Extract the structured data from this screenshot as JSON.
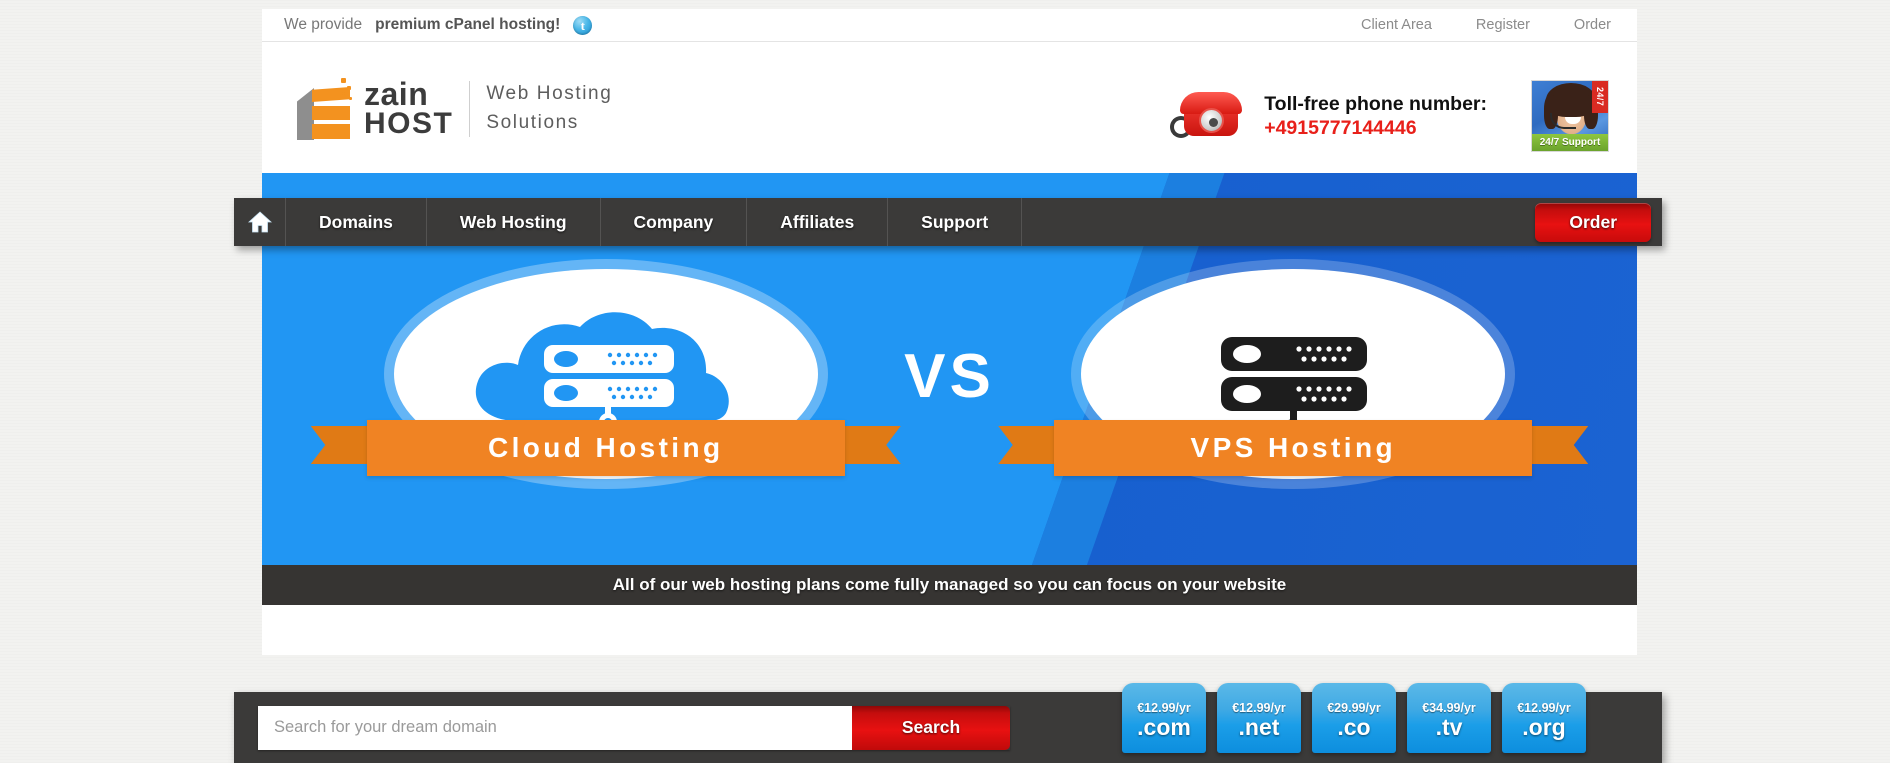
{
  "topbar": {
    "message_prefix": "We provide ",
    "message_bold": "premium cPanel hosting!",
    "social_icon": "twitter-icon",
    "links": [
      {
        "label": "Client Area"
      },
      {
        "label": "Register"
      },
      {
        "label": "Order"
      }
    ]
  },
  "header": {
    "logo": {
      "line1": "zain",
      "line2": "HOST",
      "tagline_line1": "Web Hosting",
      "tagline_line2": "Solutions",
      "mark_color_orange": "#f3921f",
      "mark_color_gray": "#8e8e8e"
    },
    "phone": {
      "icon": "telephone-icon",
      "label": "Toll-free phone number:",
      "number": "+4915777144446",
      "number_color": "#e8201a"
    },
    "support_badge": {
      "corner_label": "24/7",
      "caption": "24/7 Support"
    }
  },
  "nav": {
    "home_icon": "home-icon",
    "items": [
      {
        "label": "Domains"
      },
      {
        "label": "Web Hosting"
      },
      {
        "label": "Company"
      },
      {
        "label": "Affiliates"
      },
      {
        "label": "Support"
      }
    ],
    "order_button": "Order",
    "order_color": "#e81111",
    "bar_color": "#3b3a39"
  },
  "hero": {
    "left": {
      "title": "Cloud Hosting",
      "art": "cloud-server-icon",
      "bg_color": "#2196f3"
    },
    "right": {
      "title": "VPS Hosting",
      "art": "server-rack-icon",
      "bg_color": "#1159c9"
    },
    "versus": "VS",
    "ribbon_color": "#f08323",
    "caption": "All of our web hosting plans come fully managed so you can focus on your website"
  },
  "search": {
    "placeholder": "Search for your dream domain",
    "value": "",
    "button_label": "Search",
    "tlds": [
      {
        "price": "€12.99/yr",
        "name": ".com"
      },
      {
        "price": "€12.99/yr",
        "name": ".net"
      },
      {
        "price": "€29.99/yr",
        "name": ".co"
      },
      {
        "price": "€34.99/yr",
        "name": ".tv"
      },
      {
        "price": "€12.99/yr",
        "name": ".org"
      }
    ]
  }
}
